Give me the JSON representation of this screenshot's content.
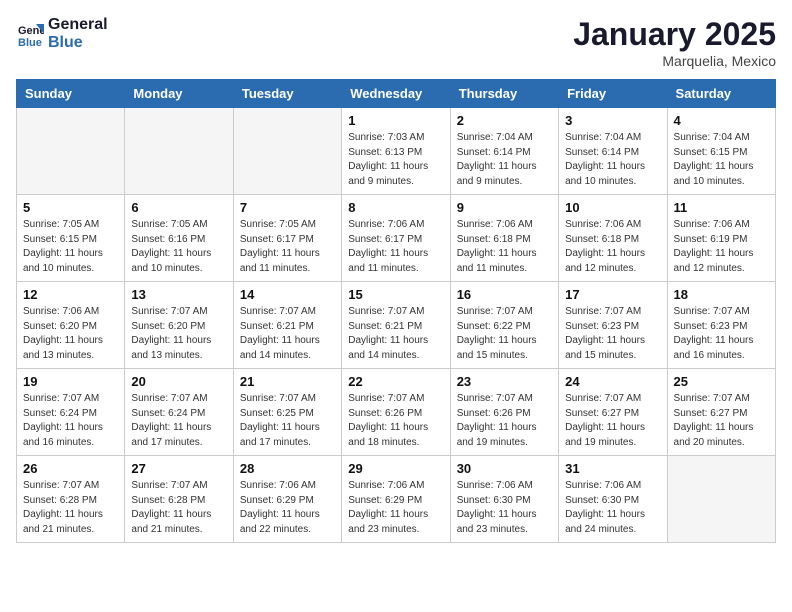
{
  "header": {
    "logo_line1": "General",
    "logo_line2": "Blue",
    "month": "January 2025",
    "location": "Marquelia, Mexico"
  },
  "weekdays": [
    "Sunday",
    "Monday",
    "Tuesday",
    "Wednesday",
    "Thursday",
    "Friday",
    "Saturday"
  ],
  "weeks": [
    [
      {
        "day": "",
        "info": ""
      },
      {
        "day": "",
        "info": ""
      },
      {
        "day": "",
        "info": ""
      },
      {
        "day": "1",
        "info": "Sunrise: 7:03 AM\nSunset: 6:13 PM\nDaylight: 11 hours\nand 9 minutes."
      },
      {
        "day": "2",
        "info": "Sunrise: 7:04 AM\nSunset: 6:14 PM\nDaylight: 11 hours\nand 9 minutes."
      },
      {
        "day": "3",
        "info": "Sunrise: 7:04 AM\nSunset: 6:14 PM\nDaylight: 11 hours\nand 10 minutes."
      },
      {
        "day": "4",
        "info": "Sunrise: 7:04 AM\nSunset: 6:15 PM\nDaylight: 11 hours\nand 10 minutes."
      }
    ],
    [
      {
        "day": "5",
        "info": "Sunrise: 7:05 AM\nSunset: 6:15 PM\nDaylight: 11 hours\nand 10 minutes."
      },
      {
        "day": "6",
        "info": "Sunrise: 7:05 AM\nSunset: 6:16 PM\nDaylight: 11 hours\nand 10 minutes."
      },
      {
        "day": "7",
        "info": "Sunrise: 7:05 AM\nSunset: 6:17 PM\nDaylight: 11 hours\nand 11 minutes."
      },
      {
        "day": "8",
        "info": "Sunrise: 7:06 AM\nSunset: 6:17 PM\nDaylight: 11 hours\nand 11 minutes."
      },
      {
        "day": "9",
        "info": "Sunrise: 7:06 AM\nSunset: 6:18 PM\nDaylight: 11 hours\nand 11 minutes."
      },
      {
        "day": "10",
        "info": "Sunrise: 7:06 AM\nSunset: 6:18 PM\nDaylight: 11 hours\nand 12 minutes."
      },
      {
        "day": "11",
        "info": "Sunrise: 7:06 AM\nSunset: 6:19 PM\nDaylight: 11 hours\nand 12 minutes."
      }
    ],
    [
      {
        "day": "12",
        "info": "Sunrise: 7:06 AM\nSunset: 6:20 PM\nDaylight: 11 hours\nand 13 minutes."
      },
      {
        "day": "13",
        "info": "Sunrise: 7:07 AM\nSunset: 6:20 PM\nDaylight: 11 hours\nand 13 minutes."
      },
      {
        "day": "14",
        "info": "Sunrise: 7:07 AM\nSunset: 6:21 PM\nDaylight: 11 hours\nand 14 minutes."
      },
      {
        "day": "15",
        "info": "Sunrise: 7:07 AM\nSunset: 6:21 PM\nDaylight: 11 hours\nand 14 minutes."
      },
      {
        "day": "16",
        "info": "Sunrise: 7:07 AM\nSunset: 6:22 PM\nDaylight: 11 hours\nand 15 minutes."
      },
      {
        "day": "17",
        "info": "Sunrise: 7:07 AM\nSunset: 6:23 PM\nDaylight: 11 hours\nand 15 minutes."
      },
      {
        "day": "18",
        "info": "Sunrise: 7:07 AM\nSunset: 6:23 PM\nDaylight: 11 hours\nand 16 minutes."
      }
    ],
    [
      {
        "day": "19",
        "info": "Sunrise: 7:07 AM\nSunset: 6:24 PM\nDaylight: 11 hours\nand 16 minutes."
      },
      {
        "day": "20",
        "info": "Sunrise: 7:07 AM\nSunset: 6:24 PM\nDaylight: 11 hours\nand 17 minutes."
      },
      {
        "day": "21",
        "info": "Sunrise: 7:07 AM\nSunset: 6:25 PM\nDaylight: 11 hours\nand 17 minutes."
      },
      {
        "day": "22",
        "info": "Sunrise: 7:07 AM\nSunset: 6:26 PM\nDaylight: 11 hours\nand 18 minutes."
      },
      {
        "day": "23",
        "info": "Sunrise: 7:07 AM\nSunset: 6:26 PM\nDaylight: 11 hours\nand 19 minutes."
      },
      {
        "day": "24",
        "info": "Sunrise: 7:07 AM\nSunset: 6:27 PM\nDaylight: 11 hours\nand 19 minutes."
      },
      {
        "day": "25",
        "info": "Sunrise: 7:07 AM\nSunset: 6:27 PM\nDaylight: 11 hours\nand 20 minutes."
      }
    ],
    [
      {
        "day": "26",
        "info": "Sunrise: 7:07 AM\nSunset: 6:28 PM\nDaylight: 11 hours\nand 21 minutes."
      },
      {
        "day": "27",
        "info": "Sunrise: 7:07 AM\nSunset: 6:28 PM\nDaylight: 11 hours\nand 21 minutes."
      },
      {
        "day": "28",
        "info": "Sunrise: 7:06 AM\nSunset: 6:29 PM\nDaylight: 11 hours\nand 22 minutes."
      },
      {
        "day": "29",
        "info": "Sunrise: 7:06 AM\nSunset: 6:29 PM\nDaylight: 11 hours\nand 23 minutes."
      },
      {
        "day": "30",
        "info": "Sunrise: 7:06 AM\nSunset: 6:30 PM\nDaylight: 11 hours\nand 23 minutes."
      },
      {
        "day": "31",
        "info": "Sunrise: 7:06 AM\nSunset: 6:30 PM\nDaylight: 11 hours\nand 24 minutes."
      },
      {
        "day": "",
        "info": ""
      }
    ]
  ]
}
